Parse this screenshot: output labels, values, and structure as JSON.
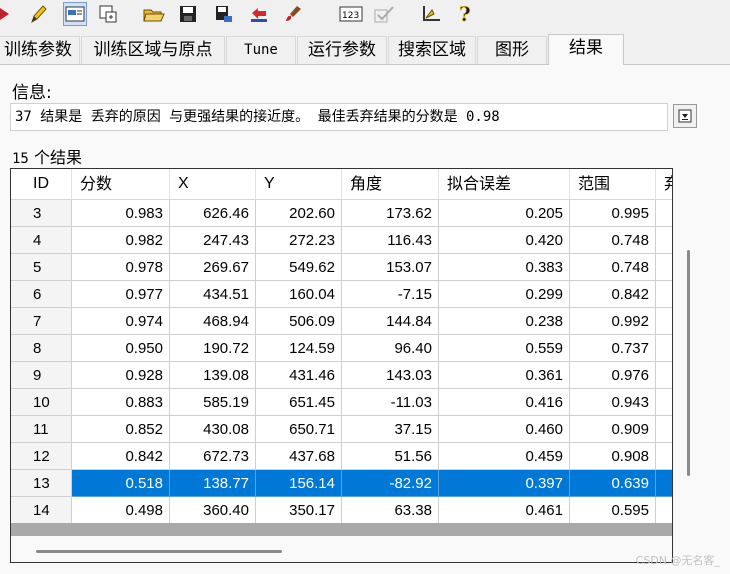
{
  "tabs": [
    {
      "label": "训练参数",
      "active": false
    },
    {
      "label": "训练区域与原点",
      "active": false
    },
    {
      "label": "Tune",
      "active": false
    },
    {
      "label": "运行参数",
      "active": false
    },
    {
      "label": "搜索区域",
      "active": false
    },
    {
      "label": "图形",
      "active": false
    },
    {
      "label": "结果",
      "active": true
    }
  ],
  "info": {
    "label": "信息:",
    "text": "37 结果是 丢弃的原因 与更强结果的接近度。  最佳丢弃结果的分数是 0.98"
  },
  "results": {
    "count": "15",
    "count_suffix": " 个结果",
    "columns": [
      "ID",
      "分数",
      "X",
      "Y",
      "角度",
      "拟合误差",
      "范围",
      "弃"
    ],
    "rows": [
      {
        "id": "3",
        "cells": [
          "0.983",
          "626.46",
          "202.60",
          "173.62",
          "0.205",
          "0.995"
        ],
        "selected": false
      },
      {
        "id": "4",
        "cells": [
          "0.982",
          "247.43",
          "272.23",
          "116.43",
          "0.420",
          "0.748"
        ],
        "selected": false
      },
      {
        "id": "5",
        "cells": [
          "0.978",
          "269.67",
          "549.62",
          "153.07",
          "0.383",
          "0.748"
        ],
        "selected": false
      },
      {
        "id": "6",
        "cells": [
          "0.977",
          "434.51",
          "160.04",
          "-7.15",
          "0.299",
          "0.842"
        ],
        "selected": false
      },
      {
        "id": "7",
        "cells": [
          "0.974",
          "468.94",
          "506.09",
          "144.84",
          "0.238",
          "0.992"
        ],
        "selected": false
      },
      {
        "id": "8",
        "cells": [
          "0.950",
          "190.72",
          "124.59",
          "96.40",
          "0.559",
          "0.737"
        ],
        "selected": false
      },
      {
        "id": "9",
        "cells": [
          "0.928",
          "139.08",
          "431.46",
          "143.03",
          "0.361",
          "0.976"
        ],
        "selected": false
      },
      {
        "id": "10",
        "cells": [
          "0.883",
          "585.19",
          "651.45",
          "-11.03",
          "0.416",
          "0.943"
        ],
        "selected": false
      },
      {
        "id": "11",
        "cells": [
          "0.852",
          "430.08",
          "650.71",
          "37.15",
          "0.460",
          "0.909"
        ],
        "selected": false
      },
      {
        "id": "12",
        "cells": [
          "0.842",
          "672.73",
          "437.68",
          "51.56",
          "0.459",
          "0.908"
        ],
        "selected": false
      },
      {
        "id": "13",
        "cells": [
          "0.518",
          "138.77",
          "156.14",
          "-82.92",
          "0.397",
          "0.639"
        ],
        "selected": true
      },
      {
        "id": "14",
        "cells": [
          "0.498",
          "360.40",
          "350.17",
          "63.38",
          "0.461",
          "0.595"
        ],
        "selected": false
      }
    ]
  },
  "watermark": "CSDN @无名客_",
  "colors": {
    "selection": "#0078d7",
    "panel": "#f9f9f9",
    "chrome": "#f0f0f0"
  }
}
